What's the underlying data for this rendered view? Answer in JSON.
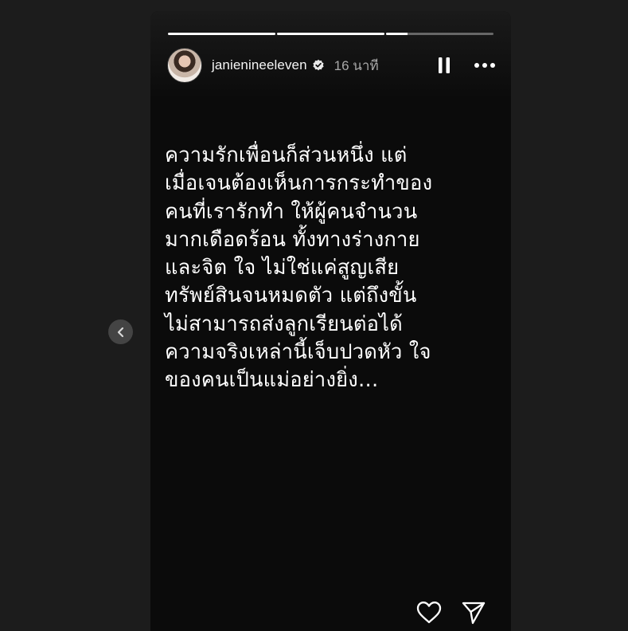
{
  "story": {
    "progress": [
      1.0,
      1.0,
      0.2
    ],
    "author": {
      "username": "janienineeleven",
      "verified": true,
      "time_ago": "16 นาที"
    },
    "controls": {
      "pause_icon": "pause-icon",
      "more_icon": "more-horizontal-icon"
    },
    "text_lines": [
      "ความรักเพื่อนก็ส่วนหนึ่ง แต่",
      "เมื่อเจนต้องเห็นการกระทำของ",
      "คนที่เรารักทำ ให้ผู้คนจำนวน",
      "มากเดือดร้อน ทั้งทางร่างกาย",
      "และจิต ใจ ไม่ใช่แค่สูญเสีย",
      "ทรัพย์สินจนหมดตัว แต่ถึงขั้น",
      "ไม่สามารถส่งลูกเรียนต่อได้",
      "ความจริงเหล่านี้เจ็บปวดหัว ใจ",
      "ของคนเป็นแม่อย่างยิ่ง…"
    ],
    "footer": {
      "like_icon": "heart-icon",
      "share_icon": "send-icon"
    }
  },
  "navigation": {
    "prev_icon": "chevron-left-icon"
  },
  "colors": {
    "page_background": "#1c1c1c",
    "story_background": "#0b0b0b",
    "text": "#ffffff",
    "muted_text": "#a8a8a8",
    "nav_button": "#444444"
  }
}
